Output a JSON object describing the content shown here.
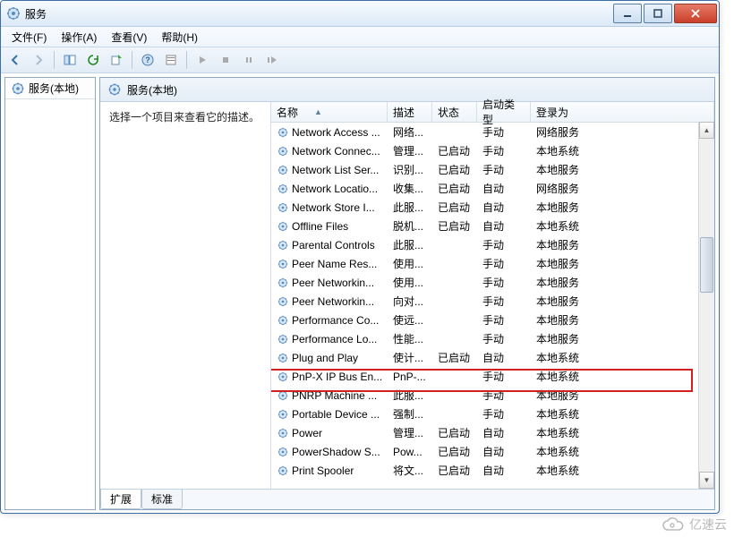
{
  "window": {
    "title": "服务"
  },
  "menu": {
    "file": "文件(F)",
    "action": "操作(A)",
    "view": "查看(V)",
    "help": "帮助(H)"
  },
  "tree": {
    "root": "服务(本地)"
  },
  "detail": {
    "header": "服务(本地)",
    "prompt": "选择一个项目来查看它的描述。"
  },
  "columns": {
    "name": "名称",
    "desc": "描述",
    "status": "状态",
    "startup": "启动类型",
    "logon": "登录为"
  },
  "services": [
    {
      "name": "Network Access ...",
      "desc": "网络...",
      "status": "",
      "startup": "手动",
      "logon": "网络服务"
    },
    {
      "name": "Network Connec...",
      "desc": "管理...",
      "status": "已启动",
      "startup": "手动",
      "logon": "本地系统"
    },
    {
      "name": "Network List Ser...",
      "desc": "识别...",
      "status": "已启动",
      "startup": "手动",
      "logon": "本地服务"
    },
    {
      "name": "Network Locatio...",
      "desc": "收集...",
      "status": "已启动",
      "startup": "自动",
      "logon": "网络服务"
    },
    {
      "name": "Network Store I...",
      "desc": "此服...",
      "status": "已启动",
      "startup": "自动",
      "logon": "本地服务"
    },
    {
      "name": "Offline Files",
      "desc": "脱机...",
      "status": "已启动",
      "startup": "自动",
      "logon": "本地系统"
    },
    {
      "name": "Parental Controls",
      "desc": "此服...",
      "status": "",
      "startup": "手动",
      "logon": "本地服务"
    },
    {
      "name": "Peer Name Res...",
      "desc": "使用...",
      "status": "",
      "startup": "手动",
      "logon": "本地服务"
    },
    {
      "name": "Peer Networkin...",
      "desc": "使用...",
      "status": "",
      "startup": "手动",
      "logon": "本地服务"
    },
    {
      "name": "Peer Networkin...",
      "desc": "向对...",
      "status": "",
      "startup": "手动",
      "logon": "本地服务"
    },
    {
      "name": "Performance Co...",
      "desc": "使远...",
      "status": "",
      "startup": "手动",
      "logon": "本地服务"
    },
    {
      "name": "Performance Lo...",
      "desc": "性能...",
      "status": "",
      "startup": "手动",
      "logon": "本地服务"
    },
    {
      "name": "Plug and Play",
      "desc": "使计...",
      "status": "已启动",
      "startup": "自动",
      "logon": "本地系统"
    },
    {
      "name": "PnP-X IP Bus En...",
      "desc": "PnP-...",
      "status": "",
      "startup": "手动",
      "logon": "本地系统"
    },
    {
      "name": "PNRP Machine ...",
      "desc": "此服...",
      "status": "",
      "startup": "手动",
      "logon": "本地服务"
    },
    {
      "name": "Portable Device ...",
      "desc": "强制...",
      "status": "",
      "startup": "手动",
      "logon": "本地系统"
    },
    {
      "name": "Power",
      "desc": "管理...",
      "status": "已启动",
      "startup": "自动",
      "logon": "本地系统"
    },
    {
      "name": "PowerShadow S...",
      "desc": "Pow...",
      "status": "已启动",
      "startup": "自动",
      "logon": "本地系统"
    },
    {
      "name": "Print Spooler",
      "desc": "将文...",
      "status": "已启动",
      "startup": "自动",
      "logon": "本地系统"
    }
  ],
  "tabs": {
    "extended": "扩展",
    "standard": "标准"
  },
  "watermark": "亿速云"
}
